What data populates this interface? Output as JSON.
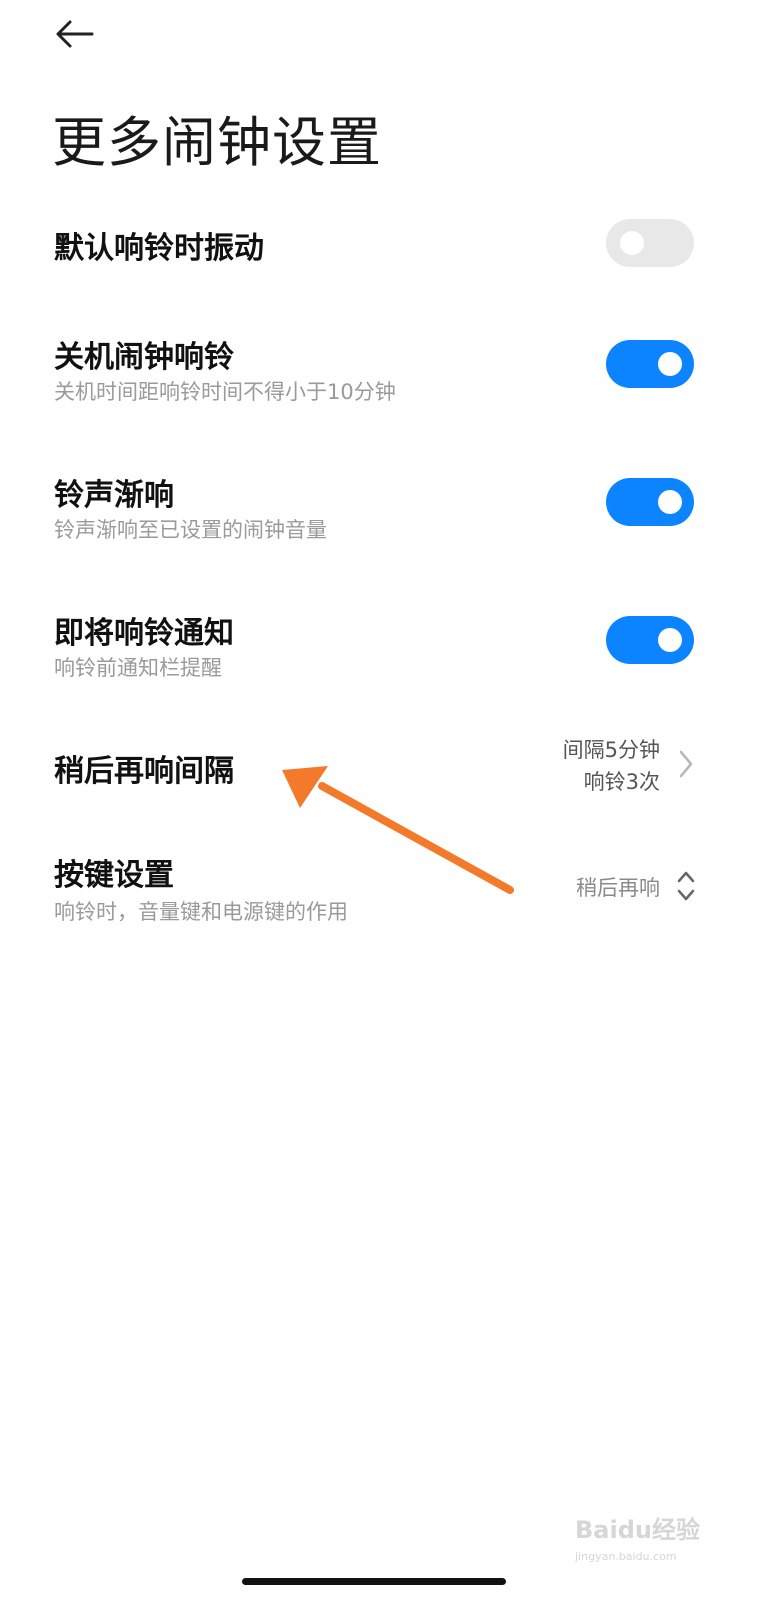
{
  "header": {
    "back_icon": "arrow-left-icon",
    "title": "更多闹钟设置"
  },
  "settings": {
    "vibrate": {
      "title": "默认响铃时振动",
      "enabled": false
    },
    "power_off_alarm": {
      "title": "关机闹钟响铃",
      "subtitle": "关机时间距响铃时间不得小于10分钟",
      "enabled": true
    },
    "fade_in": {
      "title": "铃声渐响",
      "subtitle": "铃声渐响至已设置的闹钟音量",
      "enabled": true
    },
    "upcoming_notice": {
      "title": "即将响铃通知",
      "subtitle": "响铃前通知栏提醒",
      "enabled": true
    },
    "snooze": {
      "title": "稍后再响间隔",
      "value_line1": "间隔5分钟",
      "value_line2": "响铃3次",
      "icon": "chevron-right-icon"
    },
    "button_settings": {
      "title": "按键设置",
      "subtitle": "响铃时，音量键和电源键的作用",
      "value": "稍后再响",
      "icon": "chevron-up-down-icon"
    }
  },
  "annotation": {
    "icon": "annotation-arrow-icon",
    "color": "#f47a2b"
  },
  "watermark": {
    "text": "Baidu经验",
    "url_text": "jingyan.baidu.com"
  },
  "colors": {
    "toggle_on": "#0d84ff",
    "toggle_off": "#e8e8e8"
  }
}
